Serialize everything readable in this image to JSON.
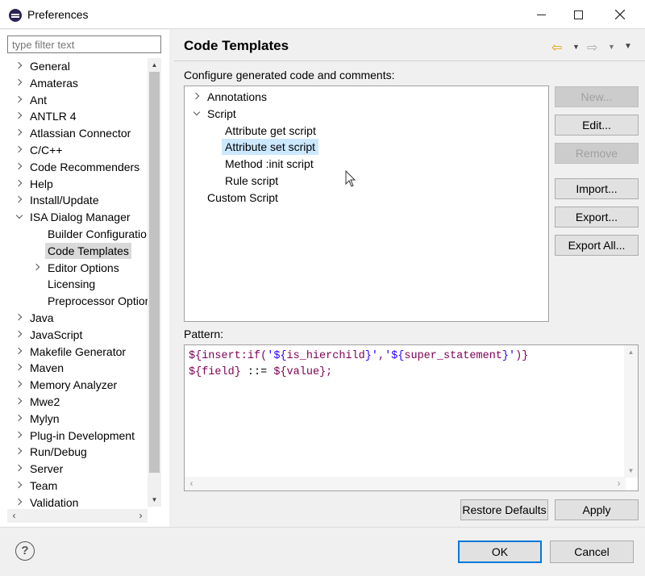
{
  "window": {
    "title": "Preferences",
    "icons": {
      "app": "eclipse-icon",
      "minimize": "minimize-icon",
      "maximize": "maximize-icon",
      "close": "close-icon"
    }
  },
  "sidebar": {
    "filter_placeholder": "type filter text",
    "items": [
      {
        "label": "General",
        "level": 0,
        "expander": "collapsed"
      },
      {
        "label": "Amateras",
        "level": 0,
        "expander": "collapsed"
      },
      {
        "label": "Ant",
        "level": 0,
        "expander": "collapsed"
      },
      {
        "label": "ANTLR 4",
        "level": 0,
        "expander": "collapsed"
      },
      {
        "label": "Atlassian Connector",
        "level": 0,
        "expander": "collapsed"
      },
      {
        "label": "C/C++",
        "level": 0,
        "expander": "collapsed"
      },
      {
        "label": "Code Recommenders",
        "level": 0,
        "expander": "collapsed"
      },
      {
        "label": "Help",
        "level": 0,
        "expander": "collapsed"
      },
      {
        "label": "Install/Update",
        "level": 0,
        "expander": "collapsed"
      },
      {
        "label": "ISA Dialog Manager",
        "level": 0,
        "expander": "expanded"
      },
      {
        "label": "Builder Configuratio",
        "level": 1,
        "expander": "none"
      },
      {
        "label": "Code Templates",
        "level": 1,
        "expander": "none",
        "selected": true
      },
      {
        "label": "Editor Options",
        "level": 1,
        "expander": "collapsed"
      },
      {
        "label": "Licensing",
        "level": 1,
        "expander": "none"
      },
      {
        "label": "Preprocessor Optior",
        "level": 1,
        "expander": "none"
      },
      {
        "label": "Java",
        "level": 0,
        "expander": "collapsed"
      },
      {
        "label": "JavaScript",
        "level": 0,
        "expander": "collapsed"
      },
      {
        "label": "Makefile Generator",
        "level": 0,
        "expander": "collapsed"
      },
      {
        "label": "Maven",
        "level": 0,
        "expander": "collapsed"
      },
      {
        "label": "Memory Analyzer",
        "level": 0,
        "expander": "collapsed"
      },
      {
        "label": "Mwe2",
        "level": 0,
        "expander": "collapsed"
      },
      {
        "label": "Mylyn",
        "level": 0,
        "expander": "collapsed"
      },
      {
        "label": "Plug-in Development",
        "level": 0,
        "expander": "collapsed"
      },
      {
        "label": "Run/Debug",
        "level": 0,
        "expander": "collapsed"
      },
      {
        "label": "Server",
        "level": 0,
        "expander": "collapsed"
      },
      {
        "label": "Team",
        "level": 0,
        "expander": "collapsed"
      },
      {
        "label": "Validation",
        "level": 0,
        "expander": "collapsed"
      }
    ]
  },
  "page": {
    "title": "Code Templates",
    "description": "Configure generated code and comments:",
    "nav_icons": {
      "back": "back-arrow-icon",
      "forward": "forward-arrow-icon",
      "menu": "view-menu-icon"
    },
    "templates": [
      {
        "label": "Annotations",
        "level": 0,
        "expander": "collapsed"
      },
      {
        "label": "Script",
        "level": 0,
        "expander": "expanded"
      },
      {
        "label": "Attribute get script",
        "level": 1,
        "expander": "none"
      },
      {
        "label": "Attribute set script",
        "level": 1,
        "expander": "none",
        "selected": true
      },
      {
        "label": "Method :init script",
        "level": 1,
        "expander": "none"
      },
      {
        "label": "Rule script",
        "level": 1,
        "expander": "none"
      },
      {
        "label": "Custom Script",
        "level": 0,
        "expander": "none"
      }
    ],
    "buttons": {
      "new": "New...",
      "edit": "Edit...",
      "remove": "Remove",
      "import": "Import...",
      "export": "Export...",
      "export_all": "Export All..."
    },
    "pattern_label": "Pattern:",
    "pattern_lines": [
      [
        {
          "t": "${",
          "c": "kw"
        },
        {
          "t": "insert:if(",
          "c": "kw"
        },
        {
          "t": "'${",
          "c": "str"
        },
        {
          "t": "is_hierchild",
          "c": "kw"
        },
        {
          "t": "}'",
          "c": "str"
        },
        {
          "t": ",",
          "c": "kw"
        },
        {
          "t": "'${",
          "c": "str"
        },
        {
          "t": "super_statement",
          "c": "kw"
        },
        {
          "t": "}'",
          "c": "str"
        },
        {
          "t": ")}",
          "c": "kw"
        }
      ],
      [
        {
          "t": "${",
          "c": "kw"
        },
        {
          "t": "field",
          "c": "kw"
        },
        {
          "t": "}",
          "c": "kw"
        },
        {
          "t": " ::= ",
          "c": ""
        },
        {
          "t": "${",
          "c": "kw"
        },
        {
          "t": "value",
          "c": "kw"
        },
        {
          "t": "};",
          "c": "kw"
        }
      ]
    ],
    "restore_defaults": "Restore Defaults",
    "apply": "Apply"
  },
  "footer": {
    "help_icon": "help-icon",
    "help_glyph": "?",
    "ok": "OK",
    "cancel": "Cancel"
  }
}
